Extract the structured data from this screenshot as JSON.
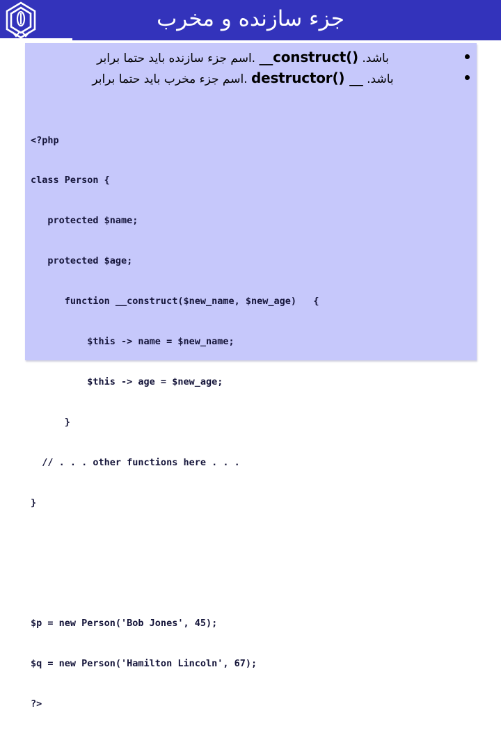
{
  "slide": {
    "title": "جزء سازنده و مخرب",
    "logo_icon": "hexagonal-emblem-logo",
    "colors": {
      "header_blue": "#3333bb",
      "panel_lavender": "#c6c8fb",
      "title_text": "#ffffff",
      "code_text": "#15153a",
      "body_text": "#000000"
    }
  },
  "bullets": [
    {
      "marker": "bullet-dot",
      "text_before": ".اسم جزء سازنده باید حتما برابر",
      "code": "__construct()",
      "text_after": "باشد."
    },
    {
      "marker": "bullet-dot",
      "text_before": ".اسم جزء مخرب باید حتما برابر",
      "code": "destructor() __",
      "text_after": "باشد."
    }
  ],
  "code_block": {
    "language": "php",
    "lines": [
      "<?php",
      "class Person {",
      "   protected $name;",
      "   protected $age;",
      "      function __construct($new_name, $new_age)   {",
      "          $this -> name = $new_name;",
      "          $this -> age = $new_age;",
      "      }",
      "  // . . . other functions here . . .",
      "}",
      "",
      "",
      "$p = new Person('Bob Jones', 45);",
      "$q = new Person('Hamilton Lincoln', 67);",
      "?>"
    ]
  }
}
